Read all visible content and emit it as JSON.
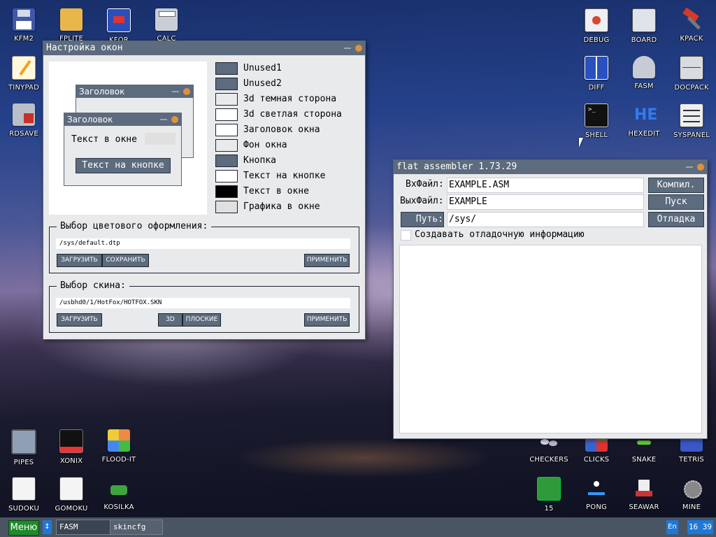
{
  "desktop": {
    "icons_top_left": [
      "KFM2",
      "FPLITE",
      "KFOR",
      "CALC",
      "TINYPAD",
      "RDSAVE"
    ],
    "icons_top_right": [
      "DEBUG",
      "BOARD",
      "KPACK",
      "DIFF",
      "FASM",
      "DOCPACK",
      "SHELL",
      "HEXEDIT",
      "SYSPANEL"
    ],
    "icons_bottom_left": [
      "PIPES",
      "XONIX",
      "FLOOD-IT",
      "SUDOKU",
      "GOMOKU",
      "KOSILKA"
    ],
    "icons_bottom_right": [
      "CHECKERS",
      "CLICKS",
      "SNAKE",
      "TETRIS",
      "15",
      "PONG",
      "SEAWAR",
      "MINE"
    ]
  },
  "skin_window": {
    "title": "Настройка окон",
    "preview": {
      "back_title": "Заголовок",
      "front_title": "Заголовок",
      "text_label": "Текст в окне",
      "button_label": "Текст на кнопке"
    },
    "color_items": [
      {
        "label": "Unused1",
        "color": "#5c6b7d"
      },
      {
        "label": "Unused2",
        "color": "#5c6b7d"
      },
      {
        "label": "3d темная сторона",
        "color": "#e9eaec"
      },
      {
        "label": "3d светлая сторона",
        "color": "#ffffff"
      },
      {
        "label": "Заголовок окна",
        "color": "#ffffff"
      },
      {
        "label": "Фон окна",
        "color": "#e9eaec"
      },
      {
        "label": "Кнопка",
        "color": "#5c6b7d"
      },
      {
        "label": "Текст на кнопке",
        "color": "#ffffff"
      },
      {
        "label": "Текст в окне",
        "color": "#000000"
      },
      {
        "label": "Графика в окне",
        "color": "#e0e0e0"
      }
    ],
    "color_group": {
      "legend": "Выбор цветового оформления:",
      "path": "/sys/default.dtp",
      "load": "ЗАГРУЗИТЬ",
      "save": "СОХРАНИТЬ",
      "apply": "ПРИМЕНИТЬ"
    },
    "skin_group": {
      "legend": "Выбор скина:",
      "path": "/usbhd0/1/HotFox/HOTFOX.SKN",
      "load": "ЗАГРУЗИТЬ",
      "btn_3d": "3D",
      "btn_flat": "ПЛОСКИЕ",
      "apply": "ПРИМЕНИТЬ"
    }
  },
  "fasm_window": {
    "title": "flat assembler 1.73.29",
    "in_label": "ВхФайл:",
    "in_value": "EXAMPLE.ASM",
    "out_label": "ВыхФайл:",
    "out_value": "EXAMPLE",
    "path_label": "Путь:",
    "path_value": "/sys/",
    "compile": "Компил.",
    "run": "Пуск",
    "debug": "Отладка",
    "debug_info": "Создавать отладочную информацию"
  },
  "taskbar": {
    "menu": "Меню",
    "tasks": [
      "FASM",
      "skincfg"
    ],
    "lang": "En",
    "time": "16 39"
  }
}
